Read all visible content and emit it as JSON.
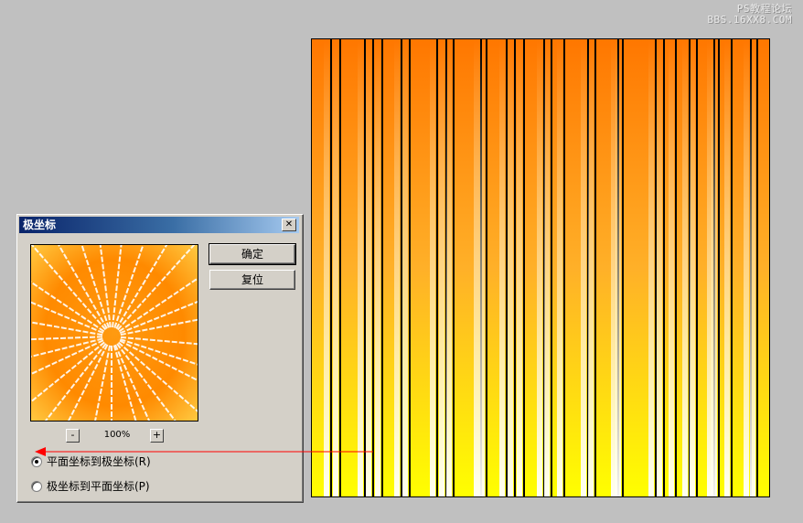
{
  "watermark": {
    "line1": "PS教程论坛",
    "line2": "BBS.16XX8.COM"
  },
  "dialog": {
    "title": "极坐标",
    "close_label": "✕",
    "ok_label": "确定",
    "reset_label": "复位",
    "zoom_out_label": "-",
    "zoom_in_label": "+",
    "zoom_level": "100%",
    "options": [
      {
        "label": "平面坐标到极坐标(R)",
        "selected": true
      },
      {
        "label": "极坐标到平面坐标(P)",
        "selected": false
      }
    ]
  },
  "colors": {
    "gradient_top": "#ff7700",
    "gradient_bottom": "#ffff00",
    "stripe_highlight": "#fff3cf",
    "stripe_line": "#000000",
    "annotation_arrow": "#ff0000",
    "titlebar_start": "#0a246a"
  }
}
